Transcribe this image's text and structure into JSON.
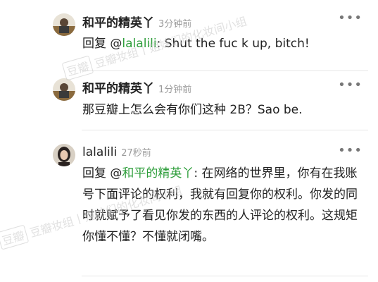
{
  "comments": [
    {
      "author": "和平的精英丫",
      "time": "3分钟前",
      "more": "•••",
      "reply_prefix": "回复 @",
      "mention": "lalalili",
      "text": ": Shut the fuc k up, bitch!"
    },
    {
      "author": "和平的精英丫",
      "time": "1分钟前",
      "more": "•••",
      "text": "那豆瓣上怎么会有你们这种 2B？Sao be."
    },
    {
      "author": "lalalili",
      "time": "27秒前",
      "more": "•••",
      "reply_prefix": "回复 @",
      "mention": "和平的精英丫",
      "text": ": 在网络的世界里，你有在我账号下面评论的权利，我就有回复你的权利。你发的同时就赋予了看见你发的东西的人评论的权利。这规矩你懂不懂？不懂就闭嘴。"
    }
  ],
  "watermark": {
    "box": "豆瓣",
    "text": "豆瓣妆组丨姐妹们的化妆间小组"
  },
  "colors": {
    "mention": "#2e9e3b",
    "time": "#9a9a9a",
    "text": "#222222"
  }
}
